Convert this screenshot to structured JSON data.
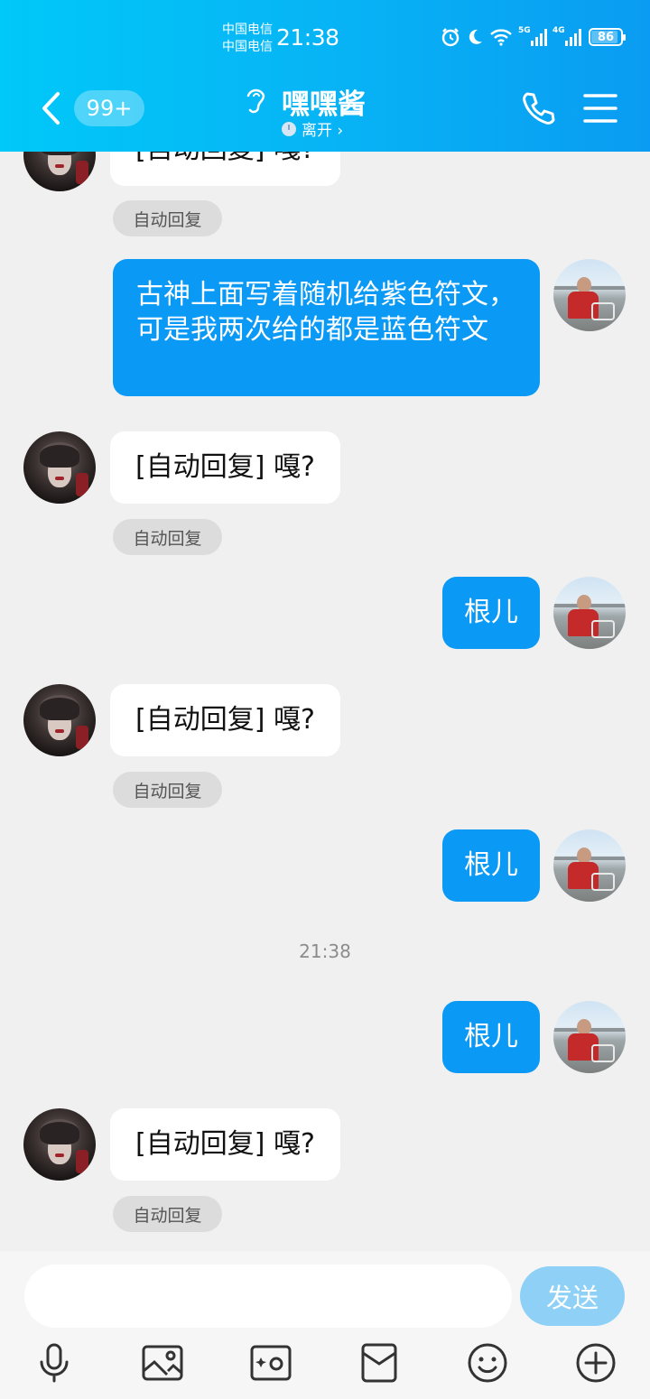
{
  "status_bar": {
    "carrier_1": "中国电信",
    "carrier_2": "中国电信",
    "time": "21:38",
    "network_1": "5G",
    "network_2": "4G",
    "battery": "86"
  },
  "header": {
    "back_icon": "chevron-left-icon",
    "unread_badge": "99+",
    "title": "嘿嘿酱",
    "presence": "离开 ›",
    "phone_icon": "phone-icon",
    "menu_icon": "menu-icon",
    "accent": "#0a99f5"
  },
  "messages": [
    {
      "side": "them",
      "text": "[自动回复] 嘎?",
      "tag": "自动回复"
    },
    {
      "side": "me",
      "text": "古神上面写着随机给紫色符文，可是我两次给的都是蓝色符文"
    },
    {
      "side": "them",
      "text": "[自动回复] 嘎?",
      "tag": "自动回复"
    },
    {
      "side": "me",
      "text": "根儿"
    },
    {
      "side": "them",
      "text": "[自动回复] 嘎?",
      "tag": "自动回复"
    },
    {
      "side": "me",
      "text": "根儿"
    },
    {
      "side": "time",
      "text": "21:38"
    },
    {
      "side": "me",
      "text": "根儿"
    },
    {
      "side": "them",
      "text": "[自动回复] 嘎?",
      "tag": "自动回复"
    }
  ],
  "composer": {
    "input_value": "",
    "send_label": "发送",
    "send_color": "#8fd0f7"
  },
  "toolbar": {
    "icons": [
      "microphone-icon",
      "image-icon",
      "camera-icon",
      "red-packet-icon",
      "emoji-icon",
      "plus-icon"
    ]
  }
}
